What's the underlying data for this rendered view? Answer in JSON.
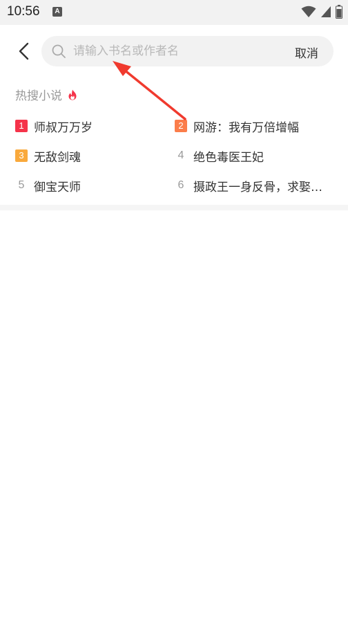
{
  "status_bar": {
    "time": "10:56",
    "notification_badge": "A"
  },
  "header": {
    "search_placeholder": "请输入书名或作者名",
    "cancel_label": "取消"
  },
  "hot_search": {
    "title": "热搜小说",
    "items": [
      {
        "rank": "1",
        "name": "师叔万万岁",
        "badge_color": "#f5334a"
      },
      {
        "rank": "2",
        "name": "网游：我有万倍增幅",
        "badge_color": "#fb7d4a"
      },
      {
        "rank": "3",
        "name": "无敌剑魂",
        "badge_color": "#f9a93c"
      },
      {
        "rank": "4",
        "name": "绝色毒医王妃",
        "badge_color": ""
      },
      {
        "rank": "5",
        "name": "御宝天师",
        "badge_color": ""
      },
      {
        "rank": "6",
        "name": "摄政王一身反骨，求娶…",
        "badge_color": ""
      }
    ]
  },
  "colors": {
    "accent_red": "#f5334a",
    "annotation_arrow": "#f03a2e"
  },
  "icons": [
    "wifi-icon",
    "signal-icon",
    "battery-icon",
    "back-arrow-icon",
    "search-icon",
    "flame-icon"
  ]
}
